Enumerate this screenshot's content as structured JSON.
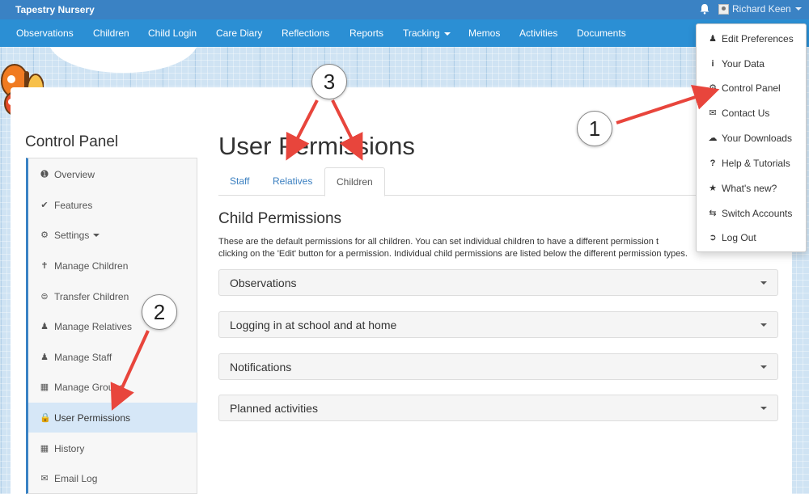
{
  "topbar": {
    "brand": "Tapestry Nursery",
    "user_name": "Richard Keen"
  },
  "nav": {
    "items": [
      "Observations",
      "Children",
      "Child Login",
      "Care Diary",
      "Reflections",
      "Reports",
      "Tracking",
      "Memos",
      "Activities",
      "Documents"
    ]
  },
  "user_dropdown": {
    "items": [
      {
        "label": "Edit Preferences",
        "icon": "user-icon"
      },
      {
        "label": "Your Data",
        "icon": "info-icon"
      },
      {
        "label": "Control Panel",
        "icon": "gear-icon"
      },
      {
        "label": "Contact Us",
        "icon": "envelope-icon"
      },
      {
        "label": "Your Downloads",
        "icon": "cloud-download-icon"
      },
      {
        "label": "Help & Tutorials",
        "icon": "question-icon"
      },
      {
        "label": "What's new?",
        "icon": "star-icon"
      },
      {
        "label": "Switch Accounts",
        "icon": "swap-icon"
      },
      {
        "label": "Log Out",
        "icon": "logout-icon"
      }
    ]
  },
  "sidebar": {
    "title": "Control Panel",
    "items": [
      {
        "label": "Overview",
        "icon": "info-circle-icon"
      },
      {
        "label": "Features",
        "icon": "check-icon"
      },
      {
        "label": "Settings",
        "icon": "gear-icon"
      },
      {
        "label": "Manage Children",
        "icon": "child-icon"
      },
      {
        "label": "Transfer Children",
        "icon": "transfer-icon"
      },
      {
        "label": "Manage Relatives",
        "icon": "user-icon"
      },
      {
        "label": "Manage Staff",
        "icon": "users-icon"
      },
      {
        "label": "Manage Groups",
        "icon": "grid-icon"
      },
      {
        "label": "User Permissions",
        "icon": "lock-icon"
      },
      {
        "label": "History",
        "icon": "calendar-icon"
      },
      {
        "label": "Email Log",
        "icon": "envelope-icon"
      }
    ],
    "active": "User Permissions"
  },
  "main": {
    "title": "User Permissions",
    "tabs": [
      "Staff",
      "Relatives",
      "Children"
    ],
    "active_tab": "Children",
    "section_title": "Child Permissions",
    "description_line1": "These are the default permissions for all children. You can set individual children to have a different permission t",
    "description_line2": "clicking on the 'Edit' button for a permission. Individual child permissions are listed below the different permission types.",
    "accordions": [
      "Observations",
      "Logging in at school and at home",
      "Notifications",
      "Planned activities"
    ]
  },
  "annotations": {
    "badge1": "1",
    "badge2": "2",
    "badge3": "3"
  },
  "colors": {
    "topbar": "#3a82c4",
    "navbar": "#2b8fd4",
    "arrow": "#e8453c",
    "active_sidebar": "#d6e7f7"
  }
}
